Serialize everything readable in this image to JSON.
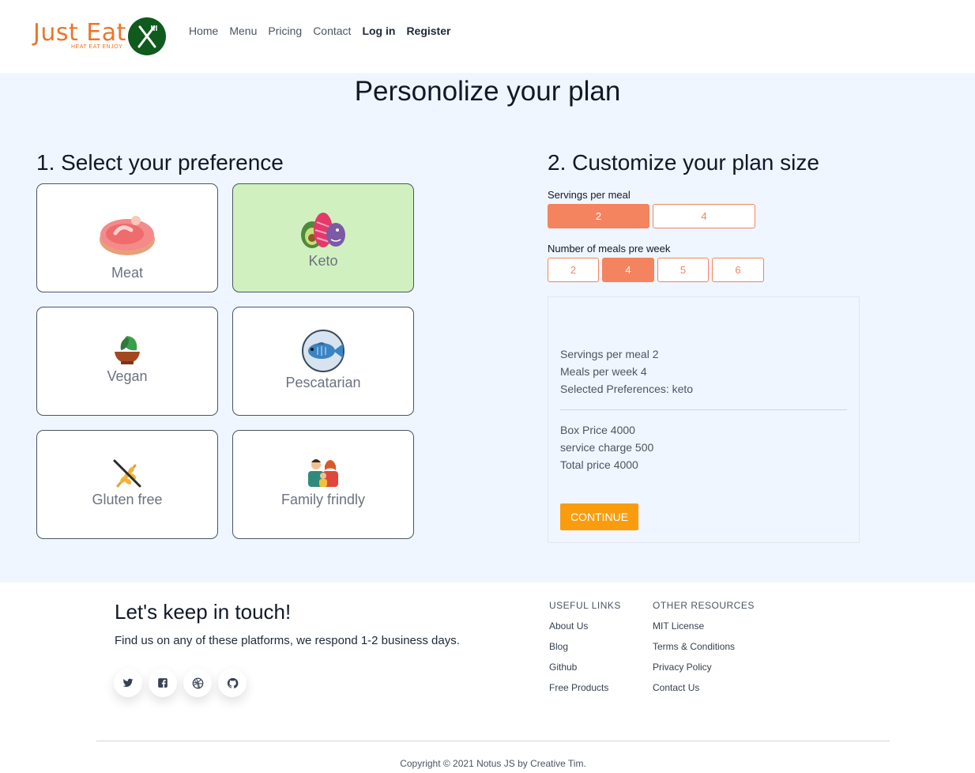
{
  "brand": {
    "name": "Just Eat",
    "tagline": "HEAT EAT ENJOY"
  },
  "nav": {
    "links": [
      "Home",
      "Menu",
      "Pricing",
      "Contact",
      "Log in",
      "Register"
    ]
  },
  "page_title": "Personolize your plan",
  "preferences": {
    "title": "1. Select your preference",
    "items": [
      {
        "label": "Meat",
        "icon": "steak-icon"
      },
      {
        "label": "Keto",
        "icon": "keto-food-icon",
        "selected": true
      },
      {
        "label": "Vegan",
        "icon": "plant-bowl-icon"
      },
      {
        "label": "Pescatarian",
        "icon": "fish-icon"
      },
      {
        "label": "Gluten free",
        "icon": "no-wheat-icon"
      },
      {
        "label": "Family frindly",
        "icon": "family-icon"
      }
    ]
  },
  "plan": {
    "title": "2. Customize your plan size",
    "servings_label": "Servings per meal",
    "servings_options": [
      "2",
      "4"
    ],
    "servings_selected": "2",
    "meals_label": "Number of meals pre week",
    "meals_options": [
      "2",
      "4",
      "5",
      "6"
    ],
    "meals_selected": "4"
  },
  "summary": {
    "servings": "Servings per meal 2",
    "meals": "Meals per week 4",
    "preferences": "Selected Preferences: keto",
    "box_price": "Box Price 4000",
    "service_charge": "service charge 500",
    "total": "Total price 4000",
    "continue_label": "CONTINUE"
  },
  "footer": {
    "title": "Let's keep in touch!",
    "subtitle": "Find us on any of these platforms, we respond 1-2 business days.",
    "social": [
      "twitter-icon",
      "facebook-icon",
      "dribbble-icon",
      "github-icon"
    ],
    "useful_links_title": "USEFUL LINKS",
    "useful_links": [
      "About Us",
      "Blog",
      "Github",
      "Free Products"
    ],
    "other_resources_title": "OTHER RESOURCES",
    "other_resources": [
      "MIT License",
      "Terms & Conditions",
      "Privacy Policy",
      "Contact Us"
    ],
    "copyright": "Copyright © 2021 Notus JS by Creative Tim."
  },
  "colors": {
    "accent": "#f4845f",
    "continue": "#f99d0f",
    "selected_card": "#d1f0c0",
    "background": "#eff6ff",
    "brand": "#e9762b"
  }
}
